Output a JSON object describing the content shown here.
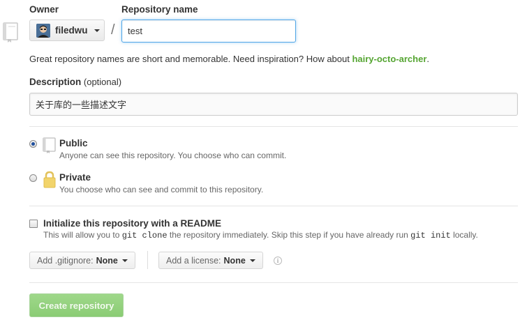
{
  "owner": {
    "label": "Owner",
    "name": "filedwu"
  },
  "repository": {
    "label": "Repository name",
    "value": "test",
    "separator": "/"
  },
  "hint": {
    "text": "Great repository names are short and memorable. Need inspiration? How about ",
    "suggestion": "hairy-octo-archer",
    "end": "."
  },
  "description": {
    "label": "Description",
    "optional": "(optional)",
    "value": "关于库的一些描述文字"
  },
  "visibility": {
    "public": {
      "title": "Public",
      "desc": "Anyone can see this repository. You choose who can commit.",
      "checked": true
    },
    "private": {
      "title": "Private",
      "desc": "You choose who can see and commit to this repository.",
      "checked": false
    }
  },
  "init": {
    "title": "Initialize this repository with a README",
    "desc_1": "This will allow you to ",
    "code_1": "git clone",
    "desc_2": " the repository immediately. Skip this step if you have already run ",
    "code_2": "git init",
    "desc_3": " locally."
  },
  "gitignore": {
    "label": "Add .gitignore:",
    "value": "None"
  },
  "license": {
    "label": "Add a license:",
    "value": "None"
  },
  "create_button": "Create repository",
  "colors": {
    "accent_green": "#55a532",
    "focus_blue": "#51a7e8",
    "create_button_bg": "#95d280"
  },
  "icons": [
    "repo-icon",
    "caret-down-icon",
    "public-repo-icon",
    "lock-icon",
    "info-icon",
    "avatar"
  ]
}
